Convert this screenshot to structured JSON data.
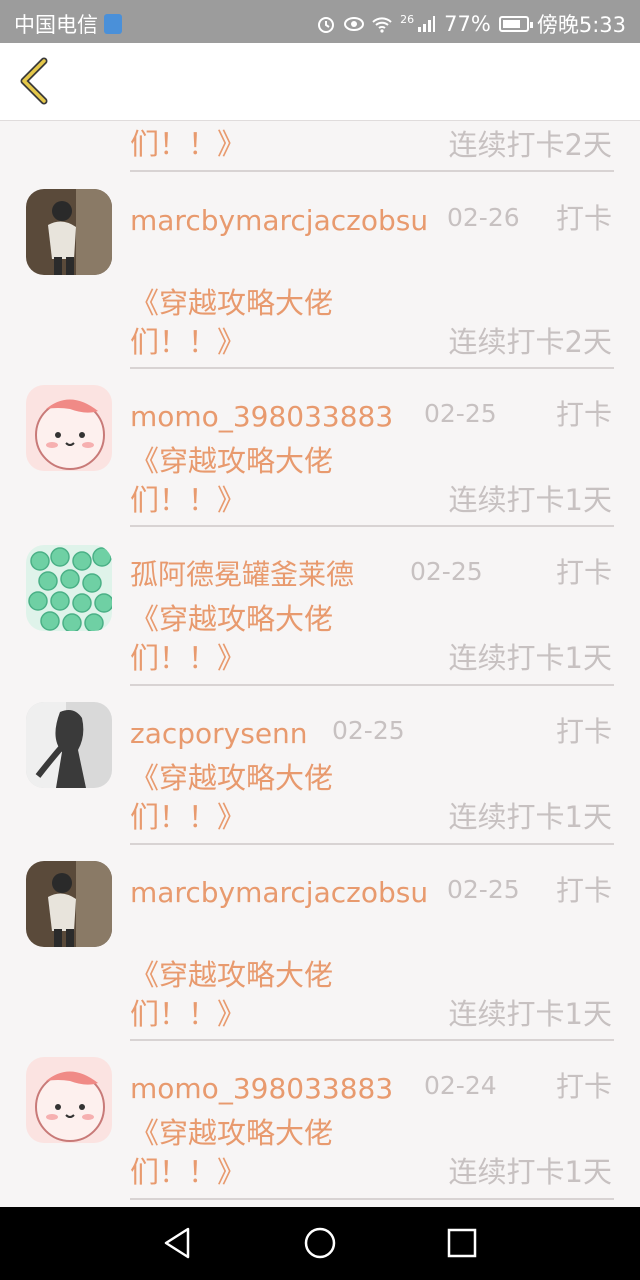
{
  "status_bar": {
    "carrier": "中国电信",
    "battery": "77%",
    "battery_level": 0.77,
    "time": "傍晚5:33",
    "network": "26"
  },
  "header": {
    "back_icon": "chevron-left-icon",
    "accent_color": "#e5c84a"
  },
  "colors": {
    "name": "#e89a6e",
    "muted": "#c7c1c1"
  },
  "partial_row": {
    "title_line2": "们！！》",
    "streak": "连续打卡2天"
  },
  "entries": [
    {
      "name": "marcbymarcjaczobsu",
      "date": "02-26",
      "checkin": "打卡",
      "title": "《穿越攻略大佬们！！》",
      "streak": "连续打卡2天",
      "avatar": "person-photo"
    },
    {
      "name": "momo_398033883",
      "date": "02-25",
      "checkin": "打卡",
      "title": "《穿越攻略大佬们！！》",
      "streak": "连续打卡1天",
      "avatar": "pink-cartoon"
    },
    {
      "name": "孤阿德冕罐釜莱德",
      "date": "02-25",
      "checkin": "打卡",
      "title": "《穿越攻略大佬们！！》",
      "streak": "连续打卡1天",
      "avatar": "green-beads"
    },
    {
      "name": "zacporysenn",
      "date": "02-25",
      "checkin": "打卡",
      "title": "《穿越攻略大佬们！！》",
      "streak": "连续打卡1天",
      "avatar": "bw-photo"
    },
    {
      "name": "marcbymarcjaczobsu",
      "date": "02-25",
      "checkin": "打卡",
      "title": "《穿越攻略大佬们！！》",
      "streak": "连续打卡1天",
      "avatar": "person-photo"
    },
    {
      "name": "momo_398033883",
      "date": "02-24",
      "checkin": "打卡",
      "title": "《穿越攻略大佬们！！》",
      "streak": "连续打卡1天",
      "avatar": "pink-cartoon"
    }
  ],
  "nav": {
    "back": "triangle-back-icon",
    "home": "circle-home-icon",
    "recents": "square-recents-icon"
  }
}
